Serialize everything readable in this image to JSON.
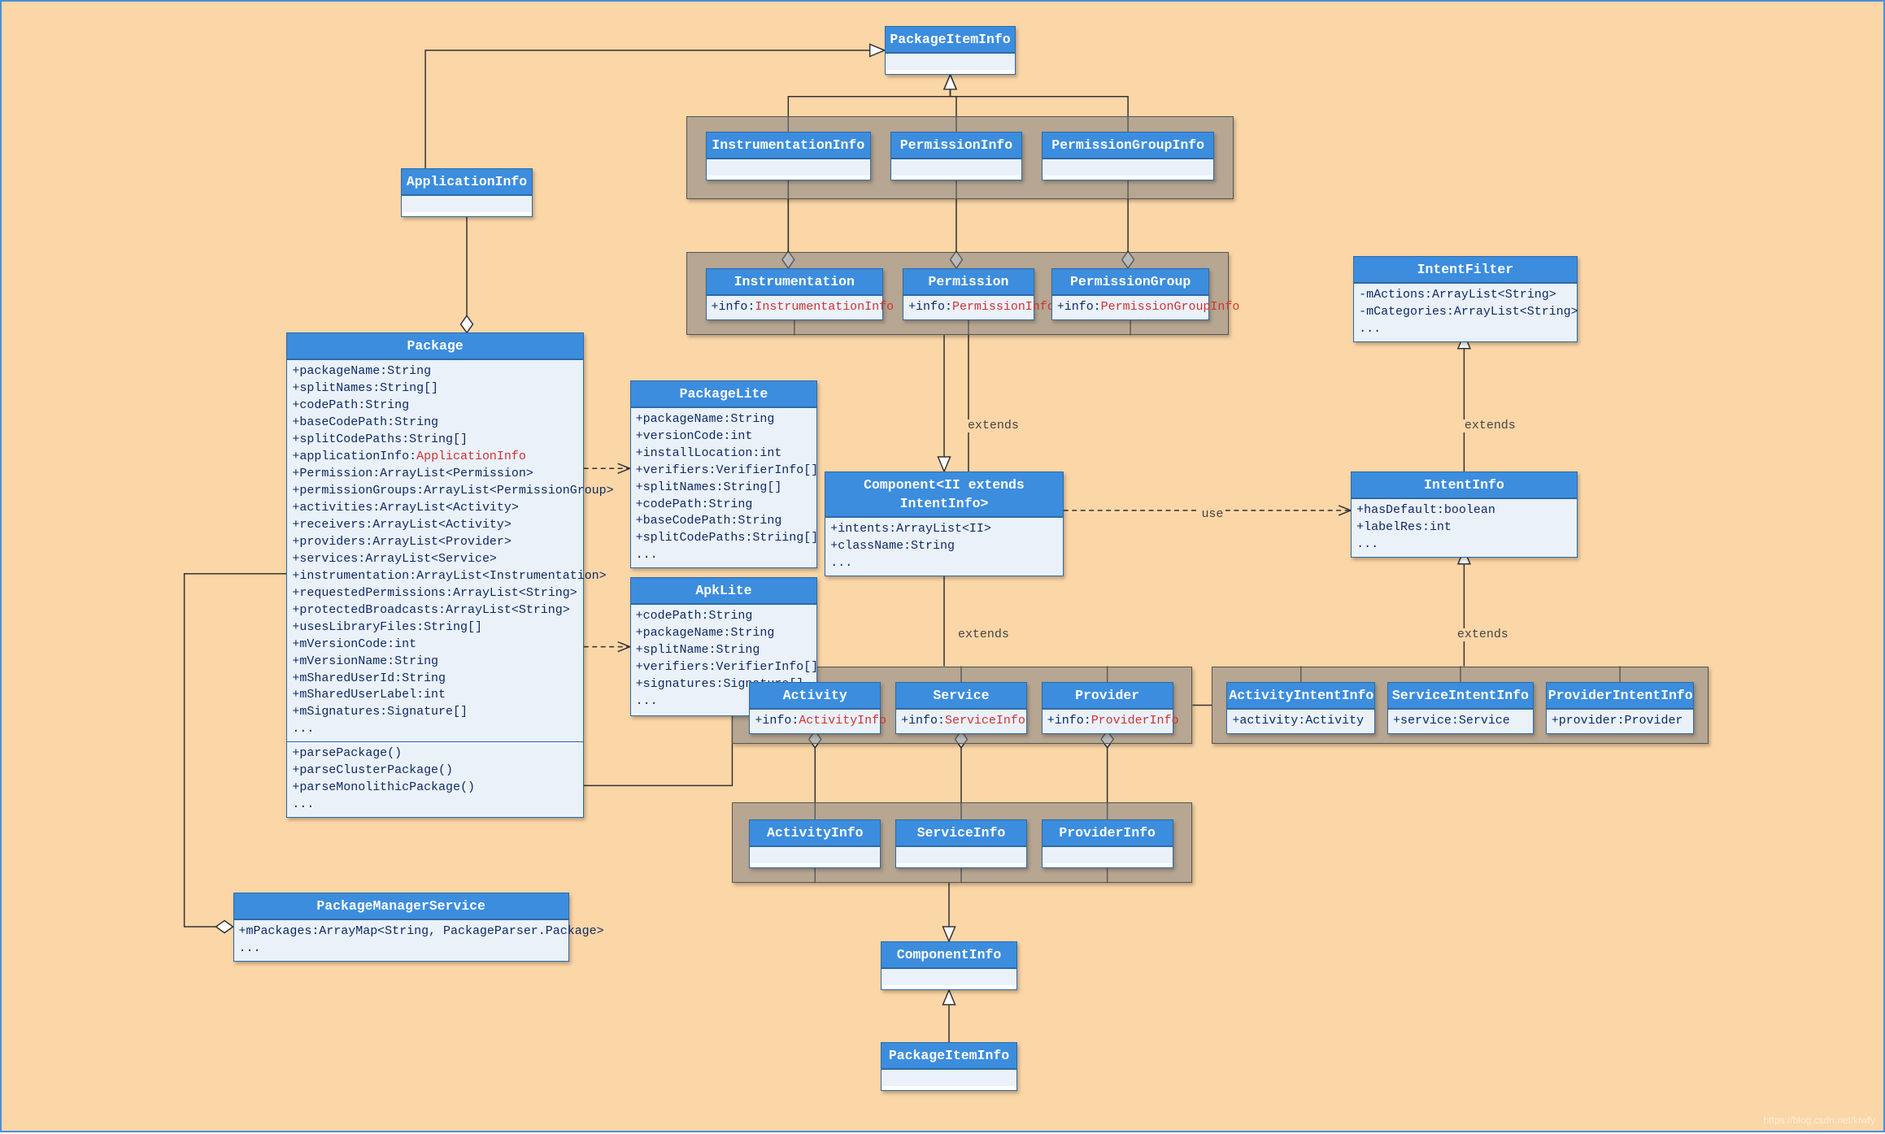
{
  "colors": {
    "bg": "#fbd6a7",
    "header": "#3c8dde",
    "border": "#2d6aa6",
    "body": "#eaf1f9"
  },
  "classes": {
    "PackageItemInfo_top": {
      "title": "PackageItemInfo"
    },
    "InstrumentationInfo": {
      "title": "InstrumentationInfo"
    },
    "PermissionInfo": {
      "title": "PermissionInfo"
    },
    "PermissionGroupInfo": {
      "title": "PermissionGroupInfo"
    },
    "ApplicationInfo": {
      "title": "ApplicationInfo"
    },
    "Instrumentation": {
      "title": "Instrumentation",
      "attrs": [
        "+info:InstrumentationInfo"
      ]
    },
    "Permission": {
      "title": "Permission",
      "attrs": [
        "+info:PermissionInfo"
      ]
    },
    "PermissionGroup": {
      "title": "PermissionGroup",
      "attrs": [
        "+info:PermissionGroupInfo"
      ]
    },
    "IntentFilter": {
      "title": "IntentFilter",
      "attrs": [
        "-mActions:ArrayList<String>",
        "-mCategories:ArrayList<String>",
        "..."
      ]
    },
    "Package": {
      "title": "Package",
      "attrs": [
        "+packageName:String",
        "+splitNames:String[]",
        "+codePath:String",
        "+baseCodePath:String",
        "+splitCodePaths:String[]",
        "+applicationInfo:ApplicationInfo",
        "+Permission:ArrayList<Permission>",
        "+permissionGroups:ArrayList<PermissionGroup>",
        "+activities:ArrayList<Activity>",
        "+receivers:ArrayList<Activity>",
        "+providers:ArrayList<Provider>",
        "+services:ArrayList<Service>",
        "+instrumentation:ArrayList<Instrumentation>",
        "+requestedPermissions:ArrayList<String>",
        "+protectedBroadcasts:ArrayList<String>",
        "+usesLibraryFiles:String[]",
        "+mVersionCode:int",
        "+mVersionName:String",
        "+mSharedUserId:String",
        "+mSharedUserLabel:int",
        "+mSignatures:Signature[]",
        "..."
      ],
      "ops": [
        "+parsePackage()",
        "+parseClusterPackage()",
        "+parseMonolithicPackage()",
        "..."
      ]
    },
    "PackageLite": {
      "title": "PackageLite",
      "attrs": [
        "+packageName:String",
        "+versionCode:int",
        "+installLocation:int",
        "+verifiers:VerifierInfo[]",
        "+splitNames:String[]",
        "+codePath:String",
        "+baseCodePath:String",
        "+splitCodePaths:Striing[]",
        "..."
      ]
    },
    "ApkLite": {
      "title": "ApkLite",
      "attrs": [
        "+codePath:String",
        "+packageName:String",
        "+splitName:String",
        "+verifiers:VerifierInfo[]",
        "+signatures:Signature[]",
        "..."
      ]
    },
    "Component": {
      "title": "Component<II extends IntentInfo>",
      "attrs": [
        "+intents:ArrayList<II>",
        "+className:String",
        "..."
      ]
    },
    "IntentInfo": {
      "title": "IntentInfo",
      "attrs": [
        "+hasDefault:boolean",
        "+labelRes:int",
        "..."
      ]
    },
    "Activity": {
      "title": "Activity",
      "attrs": [
        "+info:ActivityInfo"
      ]
    },
    "Service": {
      "title": "Service",
      "attrs": [
        "+info:ServiceInfo"
      ]
    },
    "Provider": {
      "title": "Provider",
      "attrs": [
        "+info:ProviderInfo"
      ]
    },
    "ActivityIntentInfo": {
      "title": "ActivityIntentInfo",
      "attrs": [
        "+activity:Activity"
      ]
    },
    "ServiceIntentInfo": {
      "title": "ServiceIntentInfo",
      "attrs": [
        "+service:Service"
      ]
    },
    "ProviderIntentInfo": {
      "title": "ProviderIntentInfo",
      "attrs": [
        "+provider:Provider"
      ]
    },
    "ActivityInfo": {
      "title": "ActivityInfo"
    },
    "ServiceInfo": {
      "title": "ServiceInfo"
    },
    "ProviderInfo": {
      "title": "ProviderInfo"
    },
    "ComponentInfo": {
      "title": "ComponentInfo"
    },
    "PackageItemInfo_bot": {
      "title": "PackageItemInfo"
    },
    "PackageManagerService": {
      "title": "PackageManagerService",
      "attrs": [
        "+mPackages:ArrayMap<String, PackageParser.Package>",
        "..."
      ]
    }
  },
  "labels": {
    "extends1": "extends",
    "extends2": "extends",
    "extends3": "extends",
    "extends4": "extends",
    "use": "use"
  },
  "watermark": "https://blog.csdn.net/kiwfy"
}
